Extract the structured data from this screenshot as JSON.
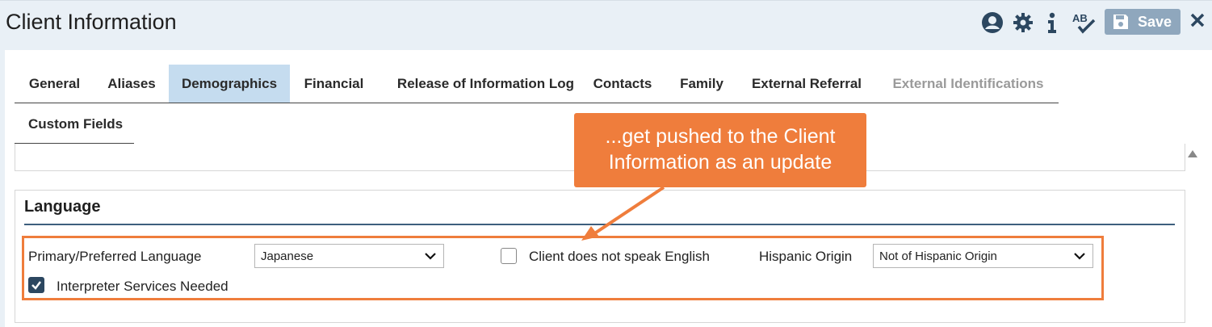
{
  "header": {
    "title": "Client Information",
    "save_label": "Save",
    "icons": [
      "user-circle-icon",
      "gear-icon",
      "info-icon",
      "spellcheck-icon",
      "floppy-disk-icon",
      "close-icon"
    ],
    "spellcheck_label": "AB"
  },
  "tabs": [
    {
      "label": "General",
      "state": "normal"
    },
    {
      "label": "Aliases",
      "state": "normal"
    },
    {
      "label": "Demographics",
      "state": "active"
    },
    {
      "label": "Financial",
      "state": "normal"
    },
    {
      "label": "Release of Information Log",
      "state": "normal"
    },
    {
      "label": "Contacts",
      "state": "normal"
    },
    {
      "label": "Family",
      "state": "normal"
    },
    {
      "label": "External Referral",
      "state": "normal"
    },
    {
      "label": "External Identifications",
      "state": "disabled"
    },
    {
      "label": "Custom Fields",
      "state": "normal"
    }
  ],
  "language_section": {
    "title": "Language",
    "primary_language_label": "Primary/Preferred Language",
    "primary_language_value": "Japanese",
    "no_english_label": "Client does not speak English",
    "no_english_checked": false,
    "hispanic_origin_label": "Hispanic Origin",
    "hispanic_origin_value": "Not of Hispanic Origin",
    "interpreter_label": "Interpreter Services Needed",
    "interpreter_checked": true
  },
  "callout": {
    "line1": "...get pushed to the Client",
    "line2": "Information as an update"
  },
  "colors": {
    "header_bg": "#e9f0f6",
    "active_tab": "#c5dcef",
    "accent_dark": "#2c4760",
    "highlight_orange": "#ef7d3c",
    "save_button": "#8fa7bd"
  }
}
